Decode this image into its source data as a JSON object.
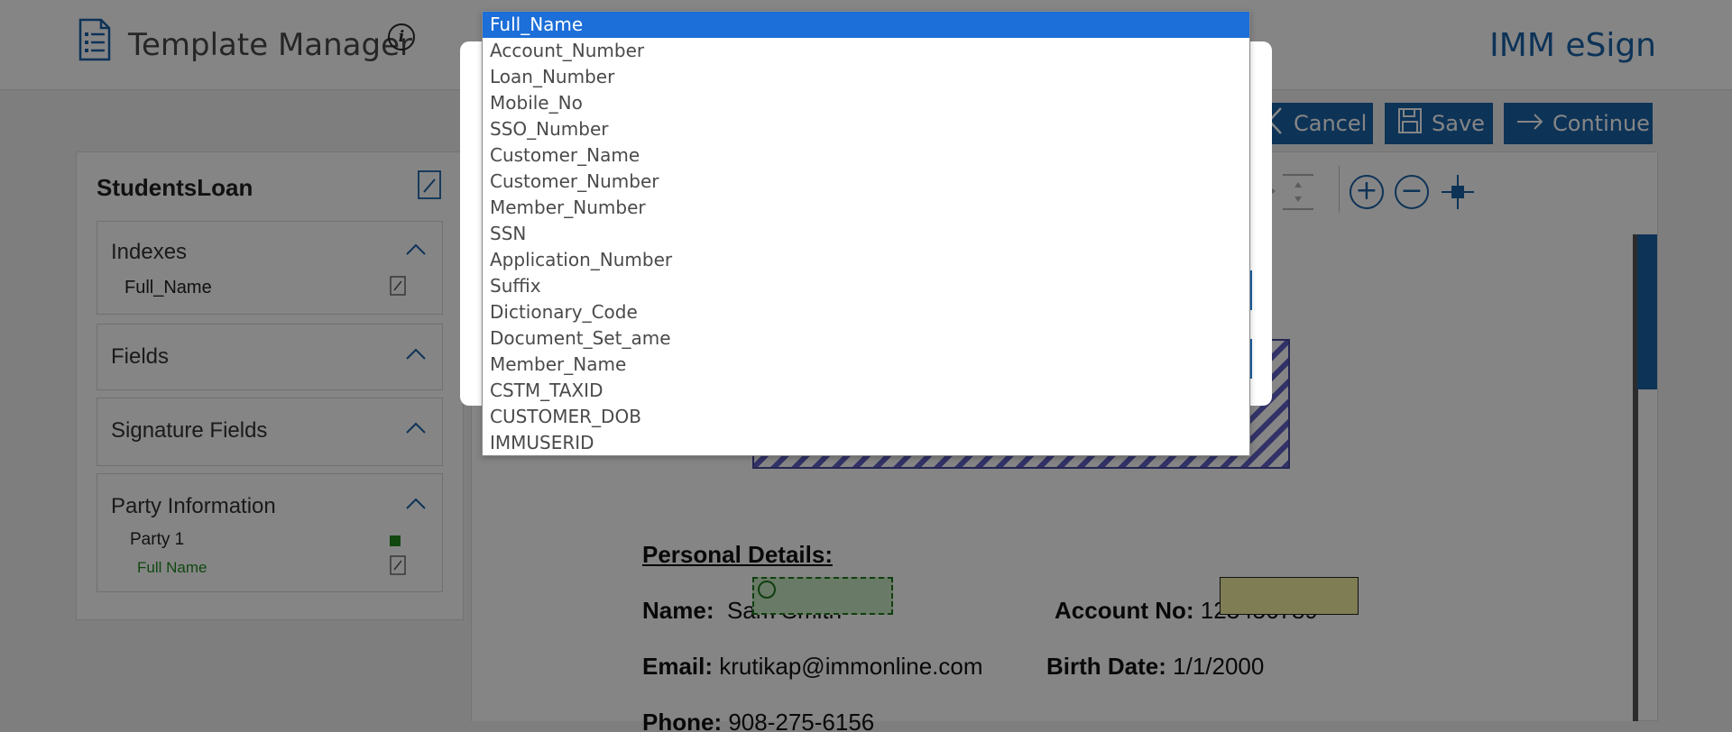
{
  "header": {
    "title": "Template Manager",
    "info_icon": "i",
    "brand": "IMM eSign"
  },
  "actions": {
    "cancel_label": "Cancel",
    "save_label": "Save",
    "continue_label": "Continue"
  },
  "left_panel": {
    "template_name": "StudentsLoan",
    "sections": {
      "indexes": {
        "title": "Indexes",
        "items": [
          "Full_Name"
        ]
      },
      "fields": {
        "title": "Fields"
      },
      "signature_fields": {
        "title": "Signature Fields"
      },
      "party_information": {
        "title": "Party Information",
        "party": "Party 1",
        "party_field": "Full Name",
        "party_color": "#1f8a1f"
      }
    }
  },
  "document": {
    "section_title": "Personal Details:",
    "name_label": "Name:",
    "name_value": "Sam Smith",
    "account_label": "Account No:",
    "account_value": "123456789",
    "email_label": "Email:",
    "email_value": "krutikap@immonline.com",
    "birth_label": "Birth Date:",
    "birth_value": "1/1/2000",
    "phone_label": "Phone:",
    "phone_value": "908-275-6156"
  },
  "dropdown": {
    "selected": "Full_Name",
    "options": [
      "Full_Name",
      "Account_Number",
      "Loan_Number",
      "Mobile_No",
      "SSO_Number",
      "Customer_Name",
      "Customer_Number",
      "Member_Number",
      "SSN",
      "Application_Number",
      "Suffix",
      "Dictionary_Code",
      "Document_Set_ame",
      "Member_Name",
      "CSTM_TAXID",
      "CUSTOMER_DOB",
      "IMMUSERID"
    ]
  },
  "colors": {
    "accent": "#1a62a8",
    "selected_option": "#1c6ed8",
    "party_green": "#1f8a1f"
  }
}
